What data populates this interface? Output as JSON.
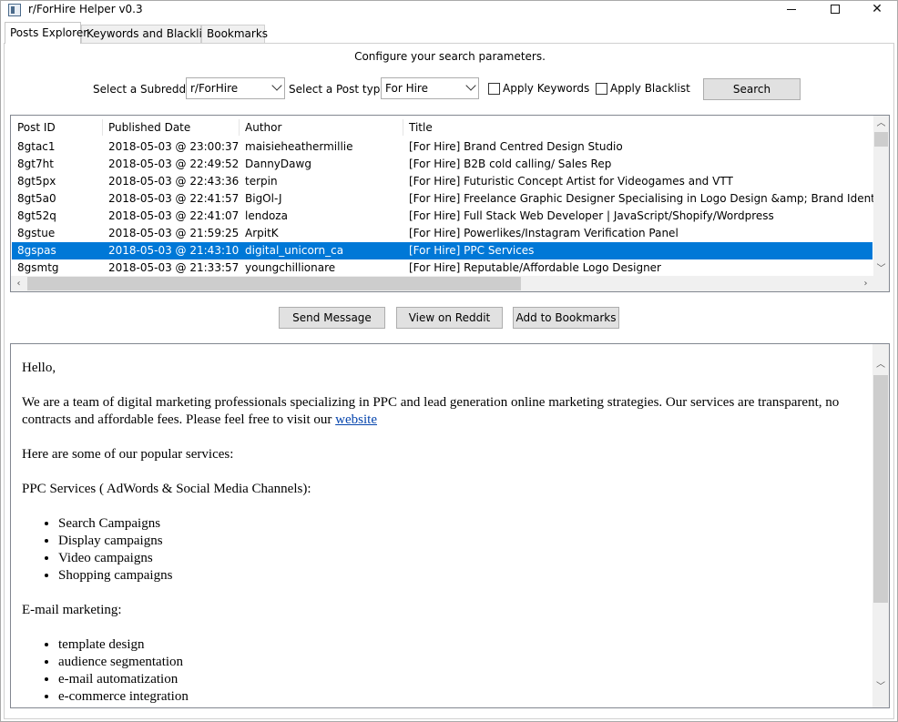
{
  "window": {
    "title": "r/ForHire Helper v0.3",
    "minimize_label": "minimize",
    "maximize_label": "maximize",
    "close_label": "close"
  },
  "tabs": [
    {
      "label": "Posts Explorer",
      "active": true
    },
    {
      "label": "Keywords and Blacklist",
      "active": false
    },
    {
      "label": "Bookmarks",
      "active": false
    }
  ],
  "config": {
    "heading": "Configure your search parameters.",
    "subreddit_label": "Select a Subreddit:",
    "subreddit_value": "r/ForHire",
    "posttype_label": "Select a Post type:",
    "posttype_value": "For Hire",
    "apply_keywords_label": "Apply Keywords",
    "apply_keywords_checked": false,
    "apply_blacklist_label": "Apply Blacklist",
    "apply_blacklist_checked": false,
    "search_label": "Search"
  },
  "table": {
    "columns": [
      "Post ID",
      "Published Date",
      "Author",
      "Title"
    ],
    "rows": [
      {
        "id": "8gtac1",
        "date": "2018-05-03 @ 23:00:37",
        "author": "maisieheathermillie",
        "title": "[For Hire] Brand Centred Design Studio"
      },
      {
        "id": "8gt7ht",
        "date": "2018-05-03 @ 22:49:52",
        "author": "DannyDawg",
        "title": "[For Hire] B2B cold calling/ Sales Rep"
      },
      {
        "id": "8gt5px",
        "date": "2018-05-03 @ 22:43:36",
        "author": "terpin",
        "title": "[For Hire] Futuristic Concept Artist for Videogames and VTT"
      },
      {
        "id": "8gt5a0",
        "date": "2018-05-03 @ 22:41:57",
        "author": "BigOl-J",
        "title": "[For Hire] Freelance Graphic Designer Specialising in Logo Design &amp; Brand Identity"
      },
      {
        "id": "8gt52q",
        "date": "2018-05-03 @ 22:41:07",
        "author": "lendoza",
        "title": "[For Hire] Full Stack Web Developer | JavaScript/Shopify/Wordpress"
      },
      {
        "id": "8gstue",
        "date": "2018-05-03 @ 21:59:25",
        "author": "ArpitK",
        "title": "[For Hire] Powerlikes/Instagram Verification Panel"
      },
      {
        "id": "8gspas",
        "date": "2018-05-03 @ 21:43:10",
        "author": "digital_unicorn_ca",
        "title": "[For Hire] PPC Services"
      },
      {
        "id": "8gsmtg",
        "date": "2018-05-03 @ 21:33:57",
        "author": "youngchillionare",
        "title": "[For Hire] Reputable/Affordable Logo Designer"
      }
    ],
    "selected_index": 6
  },
  "actions": {
    "send_message": "Send Message",
    "view_on_reddit": "View on Reddit",
    "add_to_bookmarks": "Add to Bookmarks"
  },
  "post": {
    "greeting": "Hello,",
    "intro": "We are a team of digital marketing professionals specializing in PPC and lead generation online marketing strategies. Our services are transparent, no contracts and affordable fees. Please feel free to visit our ",
    "link_text": "website",
    "services_intro": "Here are some of our popular services:",
    "ppc_heading": "PPC Services ( AdWords & Social Media Channels):",
    "ppc_items": [
      "Search Campaigns",
      "Display campaigns",
      "Video campaigns",
      "Shopping campaigns"
    ],
    "email_heading": "E-mail marketing:",
    "email_items": [
      "template design",
      "audience segmentation",
      "e-mail automatization",
      "e-commerce integration"
    ]
  },
  "colors": {
    "selection": "#0078d7",
    "link": "#0645ad"
  }
}
